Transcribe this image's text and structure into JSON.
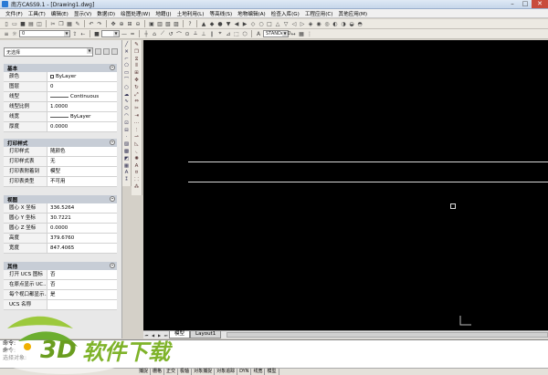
{
  "window": {
    "title": "南方CASS9.1 - [Drawing1.dwg]",
    "min": "–",
    "max": "□",
    "close": "✕"
  },
  "menu": [
    "文件(F)",
    "工具(T)",
    "编辑(E)",
    "显示(V)",
    "数据(D)",
    "绘图处理(W)",
    "地籍(J)",
    "土地利用(L)",
    "等高线(S)",
    "地物编辑(A)",
    "检查入库(G)",
    "工程应用(C)",
    "其他应用(M)"
  ],
  "toolbar2": {
    "layer_value": "0",
    "style_value": "STANDARD"
  },
  "properties": {
    "selection": "无选择",
    "sections": {
      "basic": {
        "title": "基本",
        "rows": [
          {
            "label": "颜色",
            "value": "ByLayer"
          },
          {
            "label": "图层",
            "value": "0"
          },
          {
            "label": "线型",
            "value": "Continuous"
          },
          {
            "label": "线型比例",
            "value": "1.0000"
          },
          {
            "label": "线宽",
            "value": "ByLayer"
          },
          {
            "label": "厚度",
            "value": "0.0000"
          }
        ]
      },
      "print": {
        "title": "打印样式",
        "rows": [
          {
            "label": "打印样式",
            "value": "随颜色"
          },
          {
            "label": "打印样式表",
            "value": "无"
          },
          {
            "label": "打印表附着到",
            "value": "模型"
          },
          {
            "label": "打印表类型",
            "value": "不可用"
          }
        ]
      },
      "view": {
        "title": "视图",
        "rows": [
          {
            "label": "圆心 X 坐标",
            "value": "336.5264"
          },
          {
            "label": "圆心 Y 坐标",
            "value": "30.7221"
          },
          {
            "label": "圆心 Z 坐标",
            "value": "0.0000"
          },
          {
            "label": "高度",
            "value": "379.6760"
          },
          {
            "label": "宽度",
            "value": "847.4065"
          }
        ]
      },
      "other": {
        "title": "其他",
        "rows": [
          {
            "label": "打开 UCS 图标",
            "value": "否"
          },
          {
            "label": "在原点显示 UC...",
            "value": "否"
          },
          {
            "label": "每个视口都显示...",
            "value": "是"
          },
          {
            "label": "UCS 名称",
            "value": ""
          }
        ]
      }
    }
  },
  "tabs": {
    "model": "模型",
    "layout": "Layout1"
  },
  "command": {
    "line1": "命令:",
    "line2": "命令:",
    "prompt": "选择对象:"
  },
  "status": {
    "toggles": [
      "捕捉",
      "栅格",
      "正交",
      "极轴",
      "对象捕捉",
      "对象追踪",
      "DYN",
      "线宽",
      "模型"
    ]
  },
  "watermark": {
    "text_3d": "3D",
    "text_cn": "软件下载"
  }
}
